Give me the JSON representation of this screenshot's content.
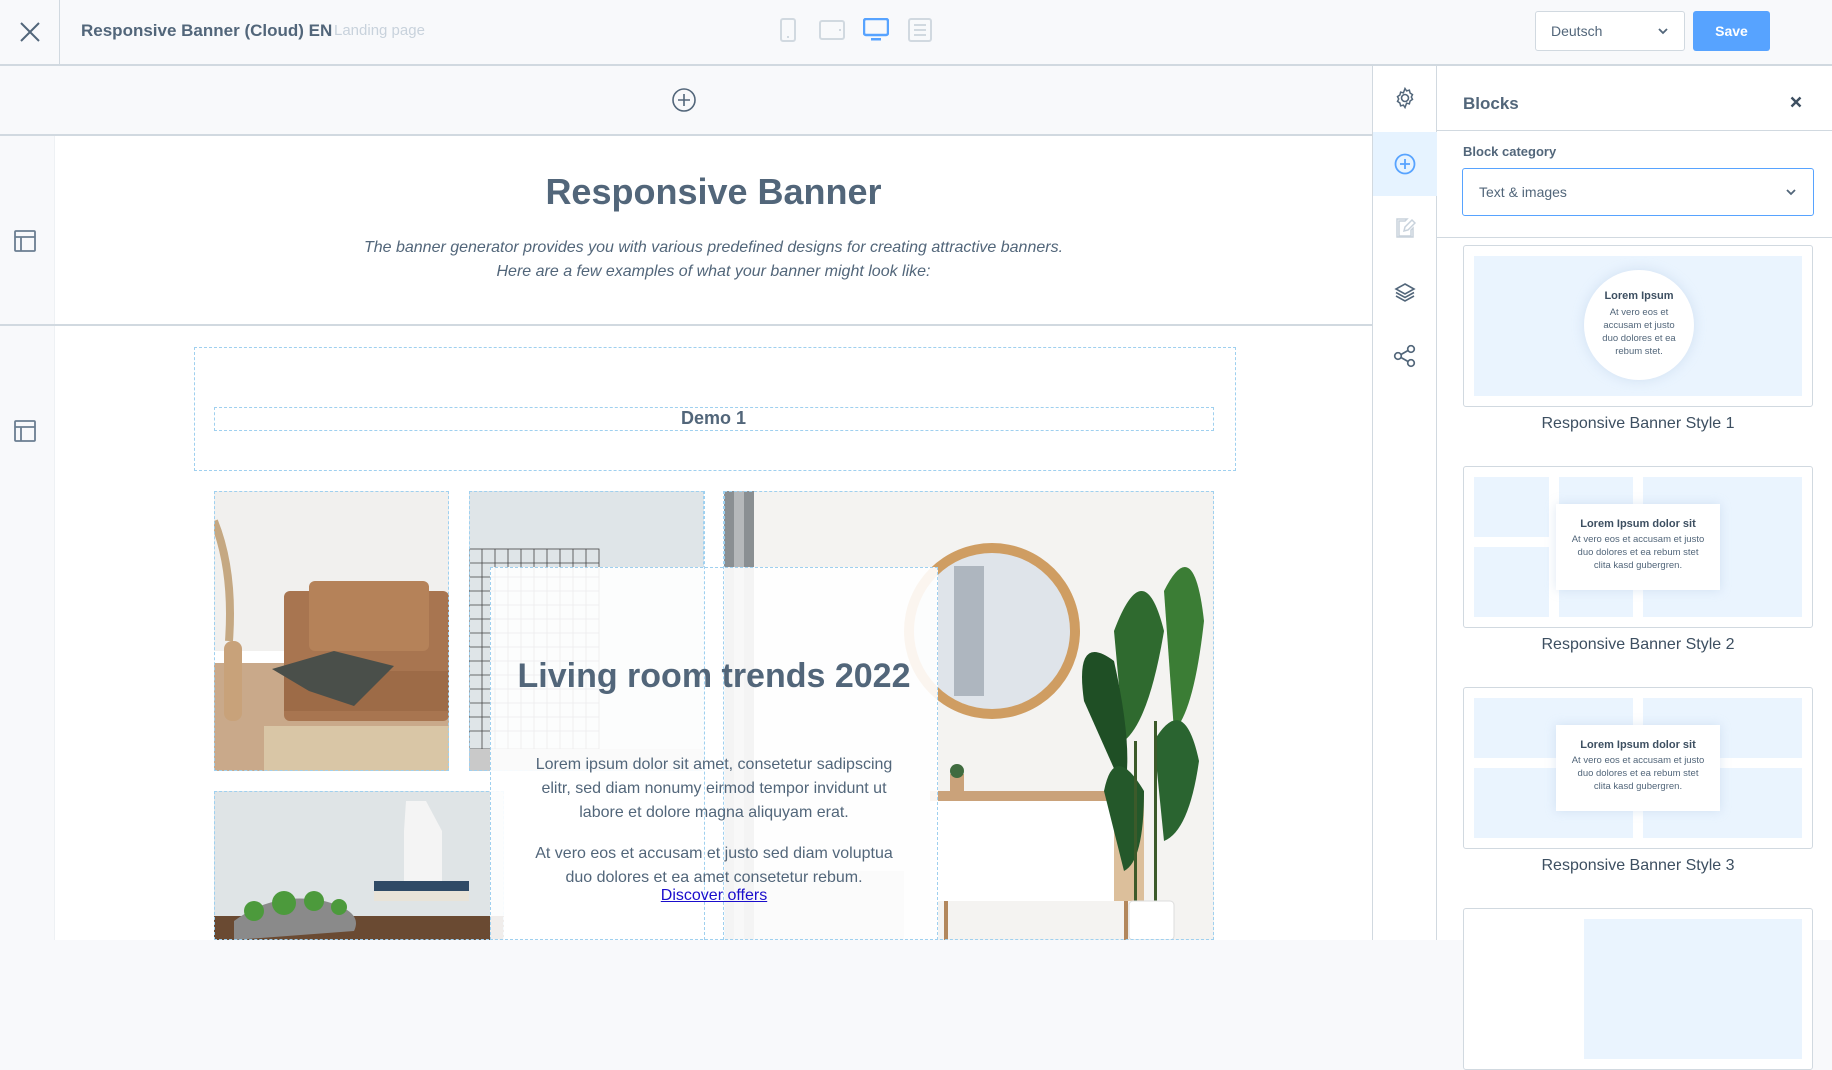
{
  "topbar": {
    "title": "Responsive Banner (Cloud) EN",
    "subtitle": "Landing page",
    "devices": [
      {
        "name": "mobile",
        "active": false
      },
      {
        "name": "tablet",
        "active": false
      },
      {
        "name": "desktop",
        "active": true
      },
      {
        "name": "list-view",
        "active": false
      }
    ],
    "language": "Deutsch",
    "save_label": "Save"
  },
  "canvas": {
    "heading": "Responsive Banner",
    "intro": "The banner generator provides you with various predefined designs for creating attractive banners. Here are a few examples of what your banner might look like:",
    "demo_title": "Demo 1",
    "banner": {
      "title": "Living room trends 2022",
      "paragraph1": "Lorem ipsum dolor sit amet, consetetur sadipscing elitr, sed diam nonumy eirmod tempor invidunt ut labore et dolore magna aliquyam erat.",
      "paragraph2": "At vero eos et accusam et justo sed diam voluptua duo dolores et ea amet consetetur rebum.",
      "link": "Discover offers"
    }
  },
  "rail": {
    "items": [
      {
        "name": "settings",
        "active": false
      },
      {
        "name": "add-block",
        "active": true
      },
      {
        "name": "edit",
        "active": false,
        "disabled": true
      },
      {
        "name": "layers",
        "active": false
      },
      {
        "name": "share",
        "active": false
      }
    ]
  },
  "panel": {
    "title": "Blocks",
    "category_label": "Block category",
    "category_value": "Text & images",
    "cards": [
      {
        "label": "Responsive Banner Style 1",
        "mini_title": "Lorem Ipsum",
        "mini_text": "At vero eos et accusam et justo duo dolores et ea rebum stet."
      },
      {
        "label": "Responsive Banner Style 2",
        "mini_title": "Lorem Ipsum dolor sit",
        "mini_text": "At vero eos et accusam et justo duo dolores et ea rebum stet clita kasd gubergren."
      },
      {
        "label": "Responsive Banner Style 3",
        "mini_title": "Lorem Ipsum dolor sit",
        "mini_text": "At vero eos et accusam et justo duo dolores et ea rebum stet clita kasd gubergren."
      }
    ]
  },
  "colors": {
    "accent": "#57a3ff",
    "text": "#52667a",
    "border": "#d1d9e0",
    "active_bg": "#e6f3ff",
    "guide": "#9fd0ef",
    "link": "#1a0dcc"
  }
}
